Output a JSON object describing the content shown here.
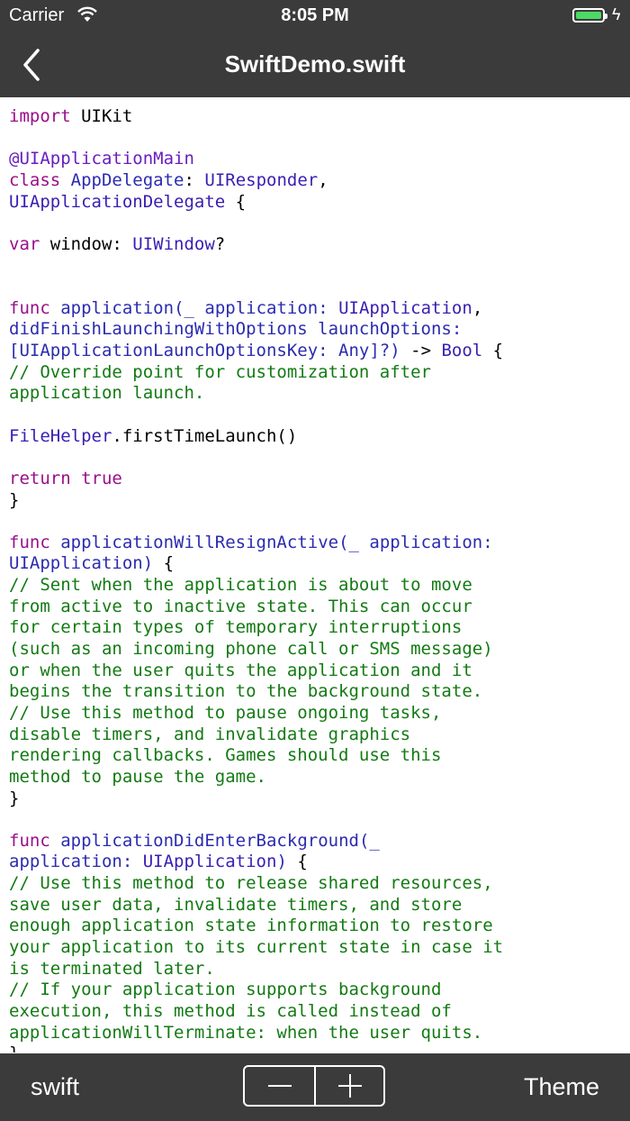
{
  "status": {
    "carrier": "Carrier",
    "time": "8:05 PM"
  },
  "nav": {
    "title": "SwiftDemo.swift"
  },
  "code": {
    "lines": [
      [
        [
          "import",
          "kw"
        ],
        [
          " UIKit",
          ""
        ]
      ],
      [],
      [
        [
          "@UIApplicationMain",
          "at"
        ]
      ],
      [
        [
          "class",
          "kw"
        ],
        [
          " ",
          ""
        ],
        [
          "AppDelegate",
          "fn"
        ],
        [
          ": ",
          ""
        ],
        [
          "UIResponder",
          "ty"
        ],
        [
          ",",
          ""
        ]
      ],
      [
        [
          "UIApplicationDelegate",
          "ty"
        ],
        [
          " {",
          ""
        ]
      ],
      [],
      [
        [
          "var",
          "kw"
        ],
        [
          " window: ",
          ""
        ],
        [
          "UIWindow",
          "ty"
        ],
        [
          "?",
          ""
        ]
      ],
      [],
      [],
      [
        [
          "func",
          "kw"
        ],
        [
          " ",
          ""
        ],
        [
          "application",
          "fn"
        ],
        [
          "(_ application: ",
          "fn"
        ],
        [
          "UIApplication",
          "ty"
        ],
        [
          ",",
          ""
        ]
      ],
      [
        [
          "didFinishLaunchingWithOptions launchOptions:",
          "fn"
        ]
      ],
      [
        [
          "[UIApplicationLaunchOptionsKey: Any]?)",
          "fn"
        ],
        [
          " -> ",
          ""
        ],
        [
          "Bool",
          "ty"
        ],
        [
          " {",
          ""
        ]
      ],
      [
        [
          "// Override point for customization after",
          "cm"
        ]
      ],
      [
        [
          "application launch.",
          "cm"
        ]
      ],
      [],
      [
        [
          "FileHelper",
          "ty"
        ],
        [
          ".firstTimeLaunch()",
          ""
        ]
      ],
      [],
      [
        [
          "return",
          "kw"
        ],
        [
          " ",
          ""
        ],
        [
          "true",
          "kw"
        ]
      ],
      [
        [
          "}",
          ""
        ]
      ],
      [],
      [
        [
          "func",
          "kw"
        ],
        [
          " ",
          ""
        ],
        [
          "applicationWillResignActive",
          "fn"
        ],
        [
          "(_ application:",
          "fn"
        ]
      ],
      [
        [
          "UIApplication)",
          "fn"
        ],
        [
          " {",
          ""
        ]
      ],
      [
        [
          "// Sent when the application is about to move",
          "cm"
        ]
      ],
      [
        [
          "from active to inactive state. This can occur",
          "cm"
        ]
      ],
      [
        [
          "for certain types of temporary interruptions",
          "cm"
        ]
      ],
      [
        [
          "(such as an incoming phone call or SMS message)",
          "cm"
        ]
      ],
      [
        [
          "or when the user quits the application and it",
          "cm"
        ]
      ],
      [
        [
          "begins the transition to the background state.",
          "cm"
        ]
      ],
      [
        [
          "// Use this method to pause ongoing tasks,",
          "cm"
        ]
      ],
      [
        [
          "disable timers, and invalidate graphics",
          "cm"
        ]
      ],
      [
        [
          "rendering callbacks. Games should use this",
          "cm"
        ]
      ],
      [
        [
          "method to pause the game.",
          "cm"
        ]
      ],
      [
        [
          "}",
          ""
        ]
      ],
      [],
      [
        [
          "func",
          "kw"
        ],
        [
          " ",
          ""
        ],
        [
          "applicationDidEnterBackground",
          "fn"
        ],
        [
          "(_",
          "fn"
        ]
      ],
      [
        [
          "application: ",
          "fn"
        ],
        [
          "UIApplication",
          "ty"
        ],
        [
          ")",
          "fn"
        ],
        [
          " {",
          ""
        ]
      ],
      [
        [
          "// Use this method to release shared resources,",
          "cm"
        ]
      ],
      [
        [
          "save user data, invalidate timers, and store",
          "cm"
        ]
      ],
      [
        [
          "enough application state information to restore",
          "cm"
        ]
      ],
      [
        [
          "your application to its current state in case it",
          "cm"
        ]
      ],
      [
        [
          "is terminated later.",
          "cm"
        ]
      ],
      [
        [
          "// If your application supports background",
          "cm"
        ]
      ],
      [
        [
          "execution, this method is called instead of",
          "cm"
        ]
      ],
      [
        [
          "applicationWillTerminate: when the user quits.",
          "cm"
        ]
      ],
      [
        [
          "}",
          ""
        ]
      ]
    ]
  },
  "toolbar": {
    "language": "swift",
    "theme": "Theme"
  },
  "colors": {
    "bar": "#3b3b3b",
    "keyword": "#9b0e8a",
    "type": "#3a1eb2",
    "function": "#2b2bb0",
    "attribute": "#6a1ebf",
    "comment": "#137a13",
    "battery": "#4cd964"
  }
}
